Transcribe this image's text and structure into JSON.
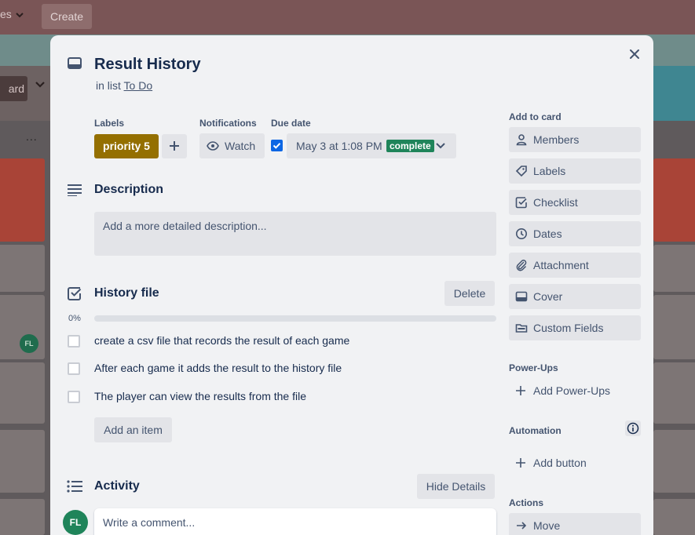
{
  "background": {
    "top_menu_label": "es",
    "create_label": "Create",
    "board_button_label": "ard",
    "list_menu": "...",
    "card_avatar": "FL"
  },
  "card": {
    "title": "Result History",
    "in_list_prefix": "in list",
    "list_name": "To Do",
    "labels_heading": "Labels",
    "label_name": "priority 5",
    "label_color": "#946f00",
    "notifications_heading": "Notifications",
    "watch_label": "Watch",
    "due_heading": "Due date",
    "due_checked": true,
    "due_date": "May 3 at 1:08 PM",
    "due_badge": "complete",
    "due_badge_color": "#1f845a"
  },
  "description": {
    "title": "Description",
    "placeholder": "Add a more detailed description..."
  },
  "checklist": {
    "title": "History file",
    "delete_label": "Delete",
    "progress_text": "0%",
    "progress_fraction": 0,
    "items": [
      {
        "text": "create a csv file that records the result of each game",
        "checked": false
      },
      {
        "text": "After each game it adds the result to the history file",
        "checked": false
      },
      {
        "text": "The player can view the results from the file",
        "checked": false
      }
    ],
    "add_item_label": "Add an item"
  },
  "activity": {
    "title": "Activity",
    "hide_details_label": "Hide Details",
    "avatar_initials": "FL",
    "comment_placeholder": "Write a comment..."
  },
  "sidebar": {
    "add_to_card_heading": "Add to card",
    "add_to_card": [
      {
        "label": "Members",
        "icon": "person-icon"
      },
      {
        "label": "Labels",
        "icon": "tag-icon"
      },
      {
        "label": "Checklist",
        "icon": "checklist-icon"
      },
      {
        "label": "Dates",
        "icon": "clock-icon"
      },
      {
        "label": "Attachment",
        "icon": "paperclip-icon"
      },
      {
        "label": "Cover",
        "icon": "cover-icon"
      },
      {
        "label": "Custom Fields",
        "icon": "custom-fields-icon"
      }
    ],
    "powerups_heading": "Power-Ups",
    "add_powerups_label": "Add Power-Ups",
    "automation_heading": "Automation",
    "add_button_label": "Add button",
    "actions_heading": "Actions",
    "move_label": "Move"
  }
}
